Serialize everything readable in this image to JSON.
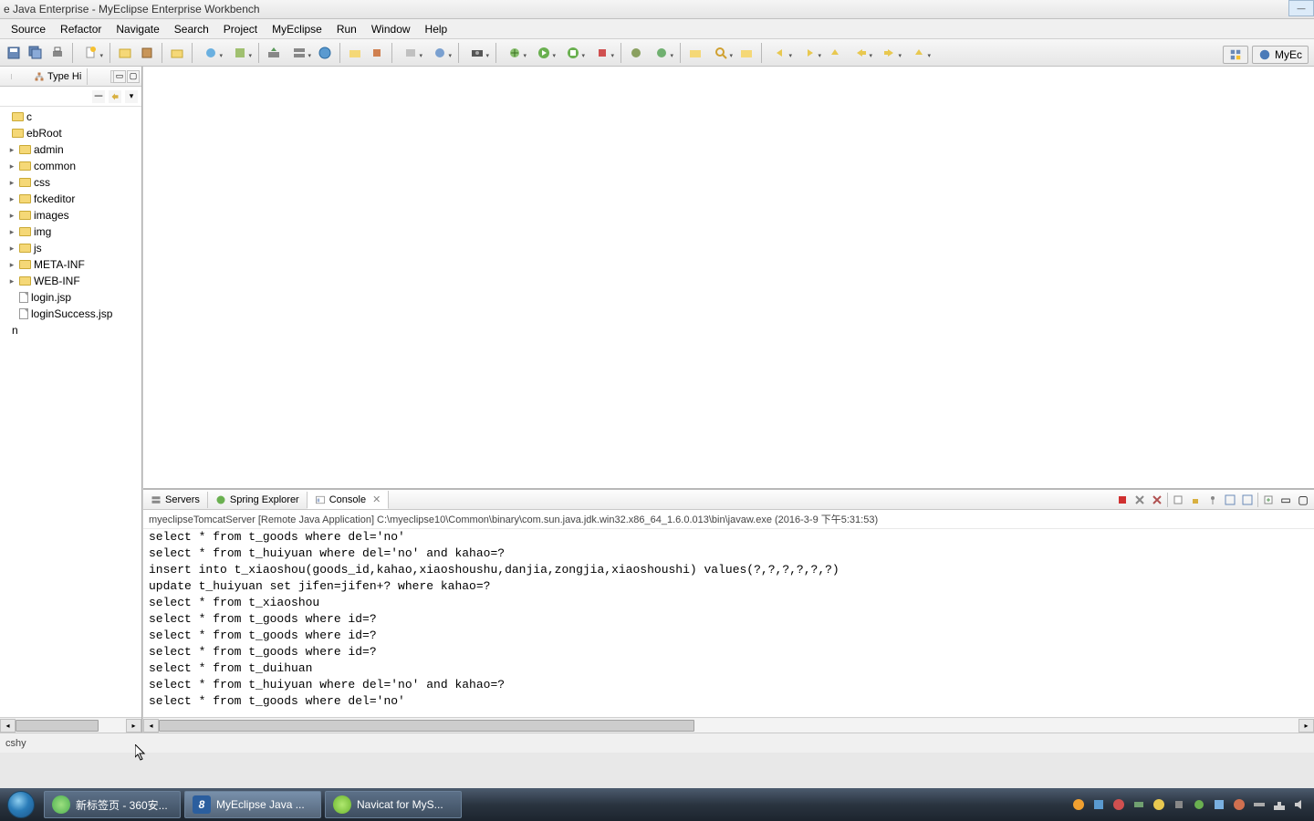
{
  "window": {
    "title": "e Java Enterprise - MyEclipse Enterprise Workbench"
  },
  "menu": [
    "Source",
    "Refactor",
    "Navigate",
    "Search",
    "Project",
    "MyEclipse",
    "Run",
    "Window",
    "Help"
  ],
  "sidebar": {
    "tab_label": "Type Hi",
    "items": [
      {
        "label": "c",
        "icon": "folder",
        "expand": ""
      },
      {
        "label": "ebRoot",
        "icon": "folder",
        "expand": ""
      },
      {
        "label": "admin",
        "icon": "folder",
        "expand": "▸",
        "indent": 1
      },
      {
        "label": "common",
        "icon": "folder",
        "expand": "▸",
        "indent": 1
      },
      {
        "label": "css",
        "icon": "folder",
        "expand": "▸",
        "indent": 1
      },
      {
        "label": "fckeditor",
        "icon": "folder",
        "expand": "▸",
        "indent": 1
      },
      {
        "label": "images",
        "icon": "folder",
        "expand": "▸",
        "indent": 1
      },
      {
        "label": "img",
        "icon": "folder",
        "expand": "▸",
        "indent": 1
      },
      {
        "label": "js",
        "icon": "folder",
        "expand": "▸",
        "indent": 1
      },
      {
        "label": "META-INF",
        "icon": "folder",
        "expand": "▸",
        "indent": 1
      },
      {
        "label": "WEB-INF",
        "icon": "folder",
        "expand": "▸",
        "indent": 1
      },
      {
        "label": "login.jsp",
        "icon": "file",
        "expand": "",
        "indent": 1
      },
      {
        "label": "loginSuccess.jsp",
        "icon": "file",
        "expand": "",
        "indent": 1
      },
      {
        "label": "n",
        "icon": "",
        "expand": "",
        "indent": 0
      }
    ]
  },
  "bottom": {
    "tabs": [
      {
        "label": "Servers",
        "icon": "servers"
      },
      {
        "label": "Spring Explorer",
        "icon": "spring"
      },
      {
        "label": "Console",
        "icon": "console",
        "active": true
      }
    ],
    "console_header": "myeclipseTomcatServer [Remote Java Application] C:\\myeclipse10\\Common\\binary\\com.sun.java.jdk.win32.x86_64_1.6.0.013\\bin\\javaw.exe (2016-3-9 下午5:31:53)",
    "console_lines": [
      "select * from t_goods where del='no'",
      "select * from t_huiyuan where del='no' and kahao=?",
      "insert into t_xiaoshou(goods_id,kahao,xiaoshoushu,danjia,zongjia,xiaoshoushi) values(?,?,?,?,?,?)",
      "update t_huiyuan set jifen=jifen+? where kahao=?",
      "select * from t_xiaoshou",
      "select * from t_goods where id=?",
      "select * from t_goods where id=?",
      "select * from t_goods where id=?",
      "select * from t_duihuan",
      "select * from t_huiyuan where del='no' and kahao=?",
      "select * from t_goods where del='no'"
    ]
  },
  "status": {
    "text": "cshy"
  },
  "perspective": {
    "label": "MyEc"
  },
  "taskbar": {
    "items": [
      {
        "label": "新标签页 - 360安...",
        "color": "#4caf50"
      },
      {
        "label": "MyEclipse Java ...",
        "color": "#2b5e9e",
        "active": true
      },
      {
        "label": "Navicat for MyS...",
        "color": "#6ab42e"
      }
    ]
  }
}
